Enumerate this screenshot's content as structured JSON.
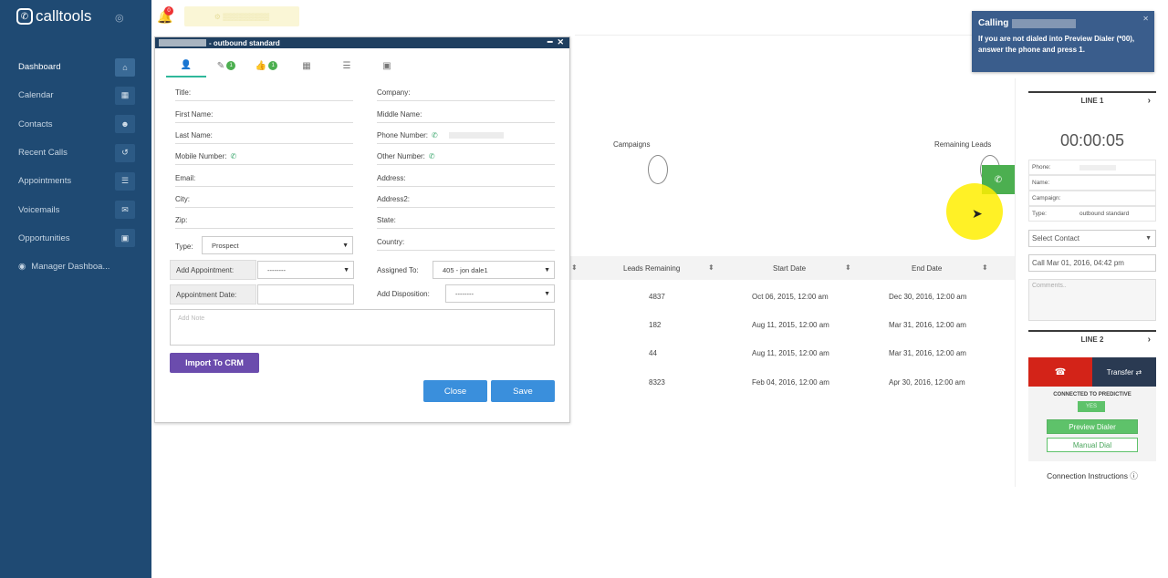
{
  "app": {
    "logo": "calltools"
  },
  "sidebar": {
    "items": [
      {
        "label": "Dashboard",
        "icon": "home-icon",
        "glyph": "⌂"
      },
      {
        "label": "Calendar",
        "icon": "calendar-icon",
        "glyph": "▦"
      },
      {
        "label": "Contacts",
        "icon": "users-icon",
        "glyph": "☻"
      },
      {
        "label": "Recent Calls",
        "icon": "history-icon",
        "glyph": "↺"
      },
      {
        "label": "Appointments",
        "icon": "list-icon",
        "glyph": "☰"
      },
      {
        "label": "Voicemails",
        "icon": "envelope-icon",
        "glyph": "✉"
      },
      {
        "label": "Opportunities",
        "icon": "briefcase-icon",
        "glyph": "▣"
      }
    ],
    "manager": "Manager Dashboa..."
  },
  "topbar": {
    "notification_count": "0"
  },
  "dashboard": {
    "campaigns_label": "Campaigns",
    "remaining_leads_label": "Remaining Leads",
    "columns": [
      "Leads Remaining",
      "Start Date",
      "End Date"
    ],
    "rows": [
      {
        "leads": "4837",
        "start": "Oct 06, 2015, 12:00 am",
        "end": "Dec 30, 2016, 12:00 am"
      },
      {
        "leads": "182",
        "start": "Aug 11, 2015, 12:00 am",
        "end": "Mar 31, 2016, 12:00 am"
      },
      {
        "leads": "44",
        "start": "Aug 11, 2015, 12:00 am",
        "end": "Mar 31, 2016, 12:00 am"
      },
      {
        "leads": "8323",
        "start": "Feb 04, 2016, 12:00 am",
        "end": "Apr 30, 2016, 12:00 am"
      }
    ]
  },
  "modal": {
    "title": "- outbound standard",
    "tabs": [
      {
        "icon": "user-icon",
        "glyph": "👤",
        "badge": ""
      },
      {
        "icon": "edit-icon",
        "glyph": "✎",
        "badge": "1"
      },
      {
        "icon": "thumbs-up-icon",
        "glyph": "👍",
        "badge": "1"
      },
      {
        "icon": "calendar-icon",
        "glyph": "▦",
        "badge": ""
      },
      {
        "icon": "list-icon",
        "glyph": "☰",
        "badge": ""
      },
      {
        "icon": "briefcase-icon",
        "glyph": "▣",
        "badge": ""
      }
    ],
    "labels": {
      "title": "Title:",
      "first_name": "First Name:",
      "last_name": "Last Name:",
      "mobile_number": "Mobile Number:",
      "email": "Email:",
      "city": "City:",
      "zip": "Zip:",
      "type": "Type:",
      "company": "Company:",
      "middle_name": "Middle Name:",
      "phone_number": "Phone Number:",
      "other_number": "Other Number:",
      "address": "Address:",
      "address2": "Address2:",
      "state": "State:",
      "country": "Country:",
      "add_appointment": "Add Appointment:",
      "appointment_date": "Appointment Date:",
      "assigned_to": "Assigned To:",
      "add_disposition": "Add Disposition:"
    },
    "type_value": "Prospect",
    "add_appointment_value": "--------",
    "assigned_to_value": "405 - jon dale1",
    "add_disposition_value": "--------",
    "note_placeholder": "Add Note",
    "import_button": "Import To CRM",
    "close_button": "Close",
    "save_button": "Save"
  },
  "calling": {
    "title": "Calling",
    "message": "If you are not dialed into Preview Dialer (*00), answer the phone and press 1."
  },
  "panel": {
    "line1": "LINE 1",
    "timer": "00:00:05",
    "phone_label": "Phone:",
    "name_label": "Name:",
    "campaign_label": "Campaign:",
    "type_label": "Type:",
    "type_value": "outbound standard",
    "select_contact": "Select Contact",
    "call_date": "Call Mar 01, 2016, 04:42 pm",
    "comments_placeholder": "Comments..",
    "line2": "LINE 2",
    "transfer": "Transfer ⇄",
    "connected": "CONNECTED TO PREDICTIVE",
    "yes": "YES",
    "preview_dialer": "Preview Dialer",
    "manual_dial": "Manual Dial",
    "connection_instructions": "Connection Instructions"
  }
}
